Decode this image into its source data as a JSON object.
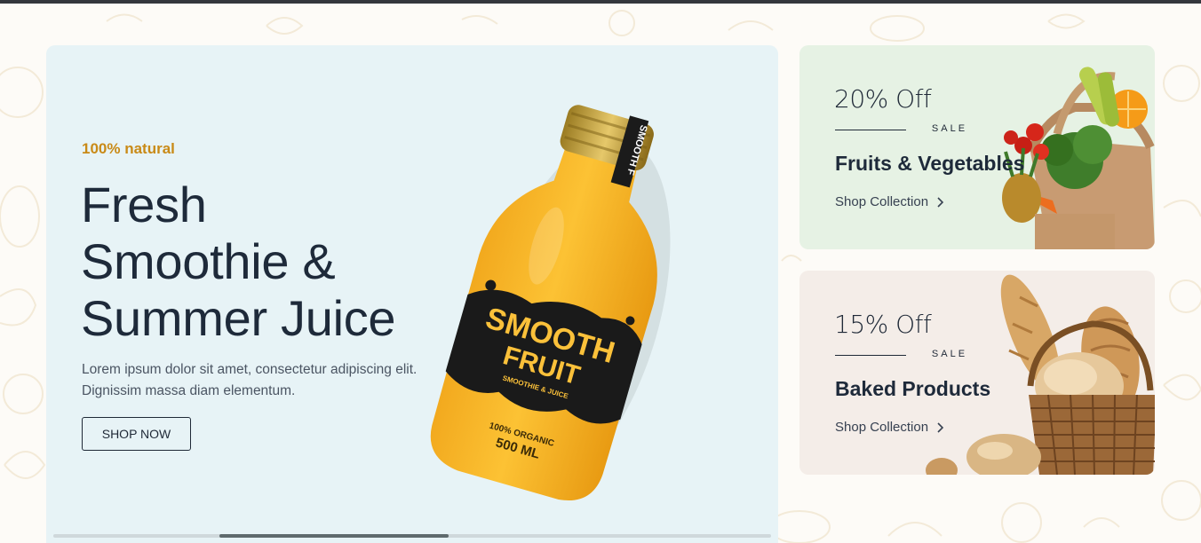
{
  "hero": {
    "eyebrow": "100% natural",
    "title_lines": [
      "Fresh",
      "Smoothie &",
      "Summer Juice"
    ],
    "description": "Lorem ipsum dolor sit amet, consectetur adipiscing elit. Dignissim massa diam elementum.",
    "button_label": "SHOP NOW",
    "product": {
      "cap_text": "SMOOTH F",
      "label_line1": "SMOOTH",
      "label_line2": "FRUIT",
      "label_sub": "SMOOTHIE & JUICE",
      "organic": "100% ORGANIC",
      "volume": "500 ML"
    },
    "slider_position": 0.34
  },
  "promos": [
    {
      "discount": "20% Off",
      "sale": "SALE",
      "name": "Fruits & Vegetables",
      "link": "Shop Collection",
      "image_icon": "vegetable-bag-image"
    },
    {
      "discount": "15% Off",
      "sale": "SALE",
      "name": "Baked Products",
      "link": "Shop Collection",
      "image_icon": "bread-basket-image"
    }
  ],
  "colors": {
    "accent": "#c98a17",
    "hero_bg": "#e7f3f6",
    "promo1_bg": "#e6f2e4",
    "promo2_bg": "#f4ede8",
    "text_dark": "#1e2a3a"
  }
}
